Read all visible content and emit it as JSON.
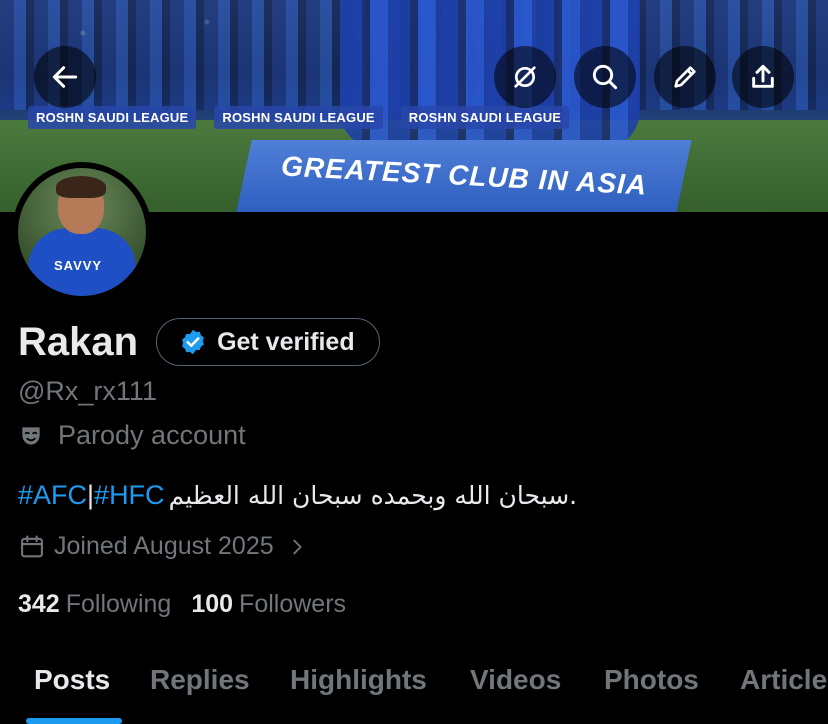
{
  "banner": {
    "league_text": [
      "ROSHN SAUDI LEAGUE",
      "ROSHN SAUDI LEAGUE",
      "ROSHN SAUDI LEAGUE"
    ],
    "slogan": "GREATEST CLUB IN ASIA"
  },
  "top_actions": {
    "back_icon": "arrow-left-icon",
    "items": [
      {
        "icon": "no-sync-icon"
      },
      {
        "icon": "search-icon"
      },
      {
        "icon": "pen-icon"
      },
      {
        "icon": "share-icon"
      }
    ]
  },
  "avatar": {
    "sponsor": "SAVVY"
  },
  "profile": {
    "name": "Rakan",
    "verify_label": "Get verified",
    "handle": "@Rx_rx111",
    "parody_label": "Parody account",
    "bio": {
      "tag1": "#AFC",
      "separator": "|",
      "tag2": "#HFC",
      "text": ".سبحان الله وبحمده سبحان الله العظيم"
    },
    "joined": "Joined August 2025",
    "following_count": "342",
    "following_label": "Following",
    "followers_count": "100",
    "followers_label": "Followers"
  },
  "tabs": [
    {
      "label": "Posts",
      "active": true
    },
    {
      "label": "Replies",
      "active": false
    },
    {
      "label": "Highlights",
      "active": false
    },
    {
      "label": "Videos",
      "active": false
    },
    {
      "label": "Photos",
      "active": false
    },
    {
      "label": "Articles",
      "active": false
    }
  ],
  "colors": {
    "accent": "#1d9bf0",
    "muted": "#71767b",
    "text": "#e7e9ea",
    "background": "#000000"
  }
}
